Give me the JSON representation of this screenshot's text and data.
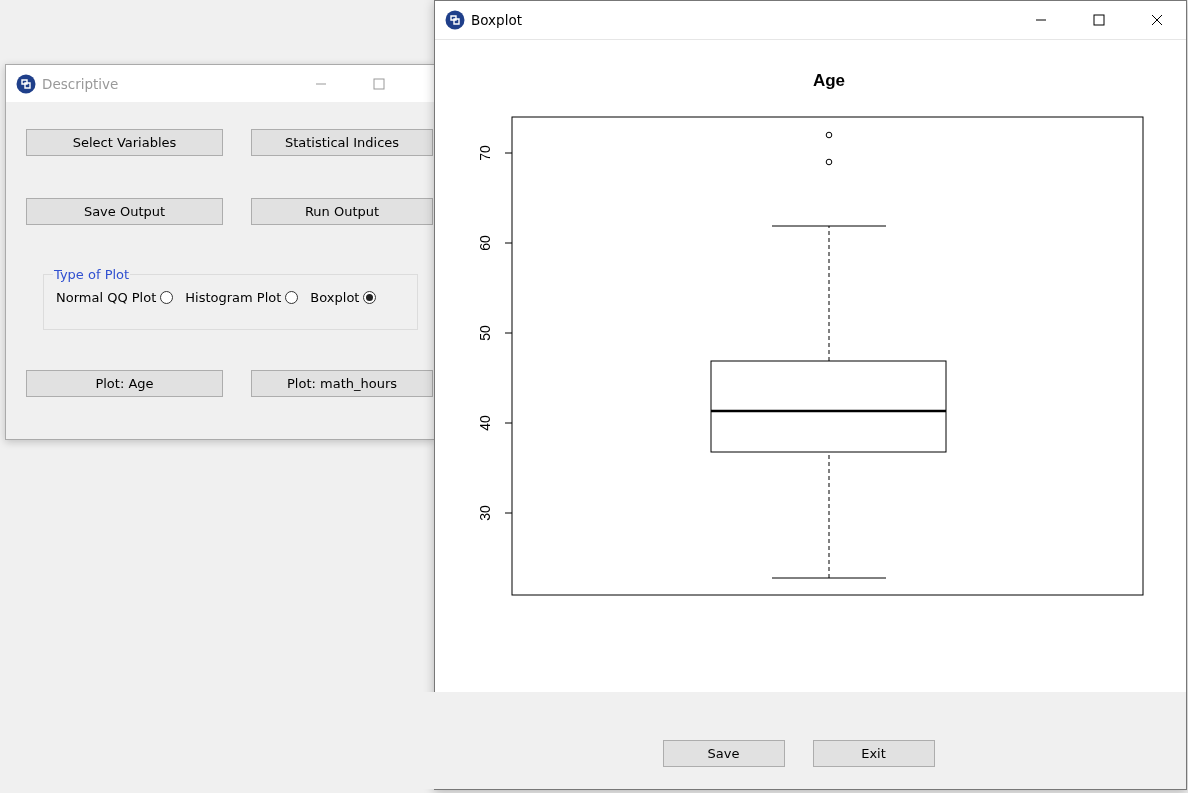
{
  "descriptive_window": {
    "title": "Descriptive",
    "active": false,
    "buttons": [
      {
        "label": "Select Variables"
      },
      {
        "label": "Statistical Indices"
      },
      {
        "label": "Save Output"
      },
      {
        "label": "Run Output"
      }
    ],
    "plot_type_group": {
      "title": "Type of Plot",
      "options": [
        {
          "label": "Normal QQ Plot",
          "selected": false
        },
        {
          "label": "Histogram Plot",
          "selected": false
        },
        {
          "label": "Boxplot",
          "selected": true
        }
      ]
    },
    "plot_buttons": [
      {
        "label": "Plot: Age"
      },
      {
        "label": "Plot: math_hours"
      }
    ]
  },
  "boxplot_window": {
    "title": "Boxplot",
    "active": true,
    "plot": {
      "title": "Age",
      "y_tick_labels": [
        "30",
        "40",
        "50",
        "60",
        "70"
      ]
    },
    "buttons": [
      {
        "label": "Save"
      },
      {
        "label": "Exit"
      }
    ]
  }
}
